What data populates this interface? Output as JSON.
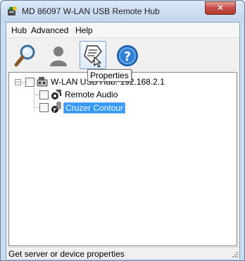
{
  "window": {
    "title": "MD 86097 W-LAN USB Remote Hub",
    "close_label": "✕",
    "app_icon": "usb-hub-app-icon"
  },
  "menu": {
    "items": [
      {
        "label": "Hub"
      },
      {
        "label": "Advanced"
      },
      {
        "label": "Help"
      }
    ]
  },
  "toolbar": {
    "buttons": [
      {
        "icon": "search-icon"
      },
      {
        "icon": "user-icon"
      },
      {
        "icon": "properties-icon"
      },
      {
        "icon": "help-icon"
      }
    ],
    "tooltip": "Properties"
  },
  "tree": {
    "root": {
      "label": "W-LAN USB Hub: 192.168.2.1",
      "expander": "−",
      "icon": "hub-icon"
    },
    "children": [
      {
        "label": "Remote Audio",
        "icon": "audio-device-icon",
        "selected": false
      },
      {
        "label": "Cruzer Contour",
        "icon": "usb-drive-icon",
        "selected": true
      }
    ]
  },
  "status": {
    "text": "Get server or device properties"
  },
  "colors": {
    "selection": "#3399ff",
    "titlebar": "#c1d6ee",
    "close_button": "#c75050"
  }
}
